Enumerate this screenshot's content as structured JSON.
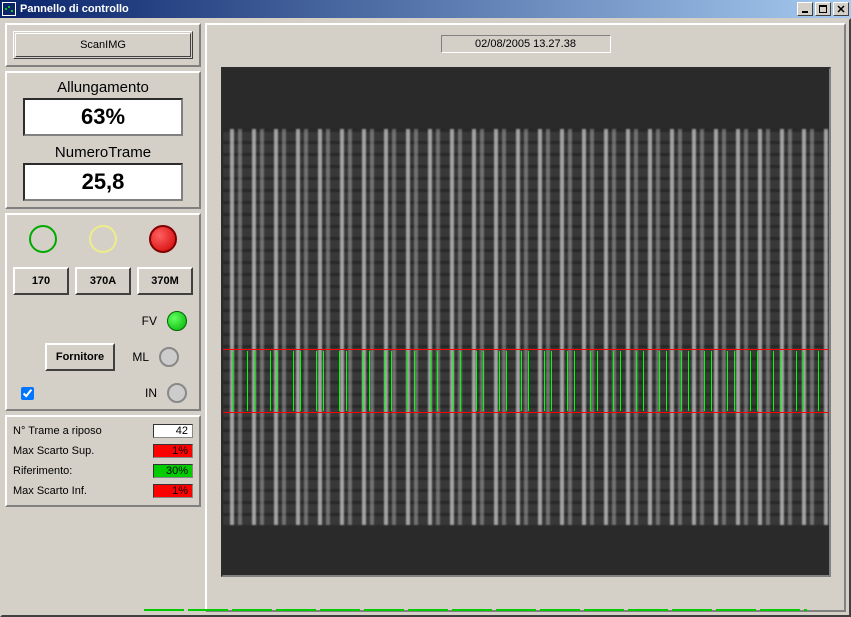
{
  "window": {
    "title": "Pannello di controllo"
  },
  "scan": {
    "label": "ScanIMG"
  },
  "metrics": {
    "allungamento_label": "Allungamento",
    "allungamento_value": "63%",
    "numerotrame_label": "NumeroTrame",
    "numerotrame_value": "25,8"
  },
  "controls": {
    "btn1": "170",
    "btn2": "370A",
    "btn3": "370M",
    "fornitore": "Fornitore",
    "fv": "FV",
    "ml": "ML",
    "in": "IN"
  },
  "table": {
    "row1_label": "N° Trame a riposo",
    "row1_value": "42",
    "row2_label": "Max Scarto  Sup.",
    "row2_value": "1%",
    "row3_label": "Riferimento:",
    "row3_value": "30%",
    "row4_label": "Max Scarto Inf.",
    "row4_value": "1%"
  },
  "timestamp": "02/08/2005 13.27.38"
}
